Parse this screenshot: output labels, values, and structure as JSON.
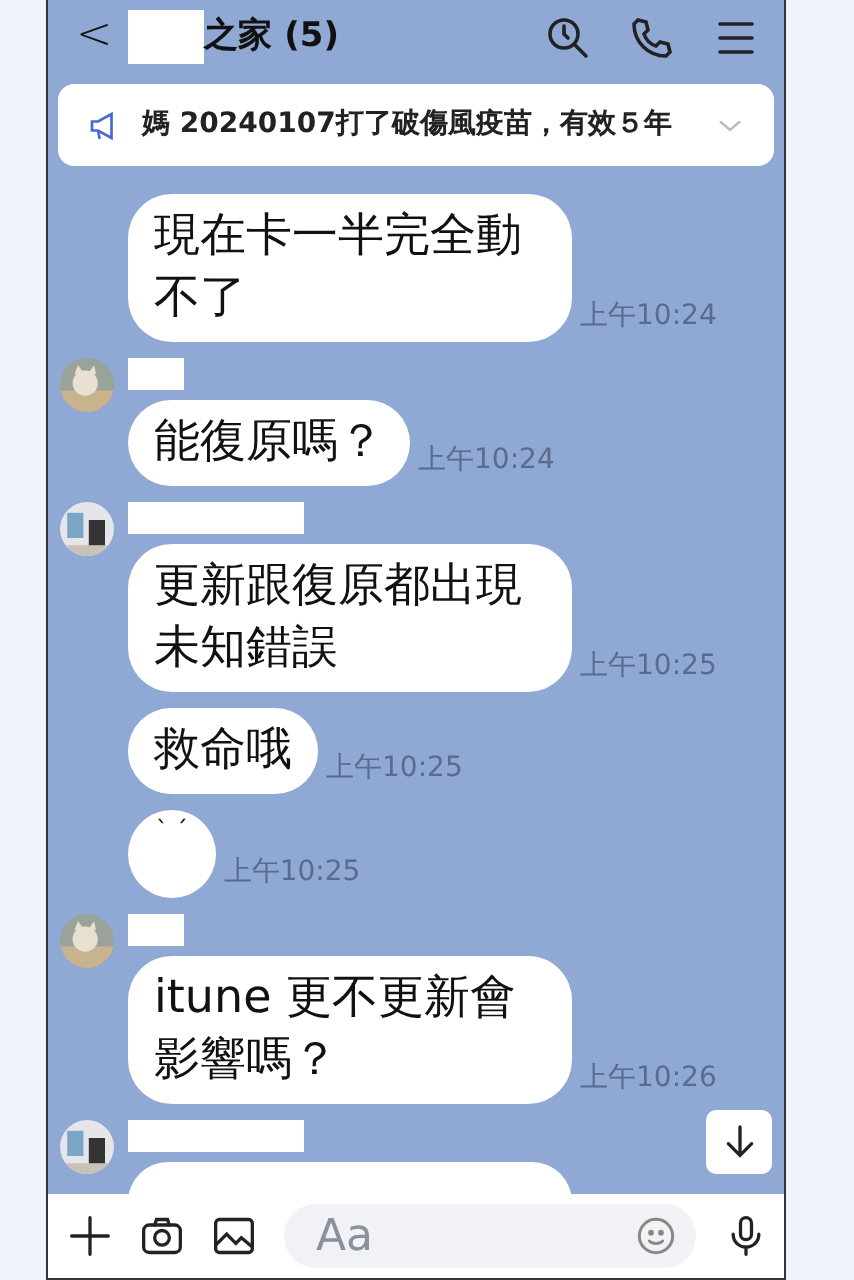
{
  "header": {
    "back": "<",
    "title": "之家 (5)",
    "name_masked": true
  },
  "pinned": {
    "text": "媽 20240107打了破傷風疫苗，有效５年"
  },
  "messages": [
    {
      "kind": "continuation",
      "text": "現在卡一半完全動不了",
      "time": "上午10:24"
    },
    {
      "kind": "first",
      "text": "能復原嗎？",
      "time": "上午10:24"
    },
    {
      "kind": "first",
      "text": "更新跟復原都出現未知錯誤",
      "time": "上午10:25"
    },
    {
      "kind": "continuation",
      "text": "救命哦",
      "time": "上午10:25"
    },
    {
      "kind": "sticker",
      "text": "ˋ ˊ",
      "time": "上午10:25"
    },
    {
      "kind": "first",
      "text": "itune 更不更新會影響嗎？",
      "time": "上午10:26"
    },
    {
      "kind": "first"
    }
  ],
  "input": {
    "placeholder": "Aa"
  }
}
